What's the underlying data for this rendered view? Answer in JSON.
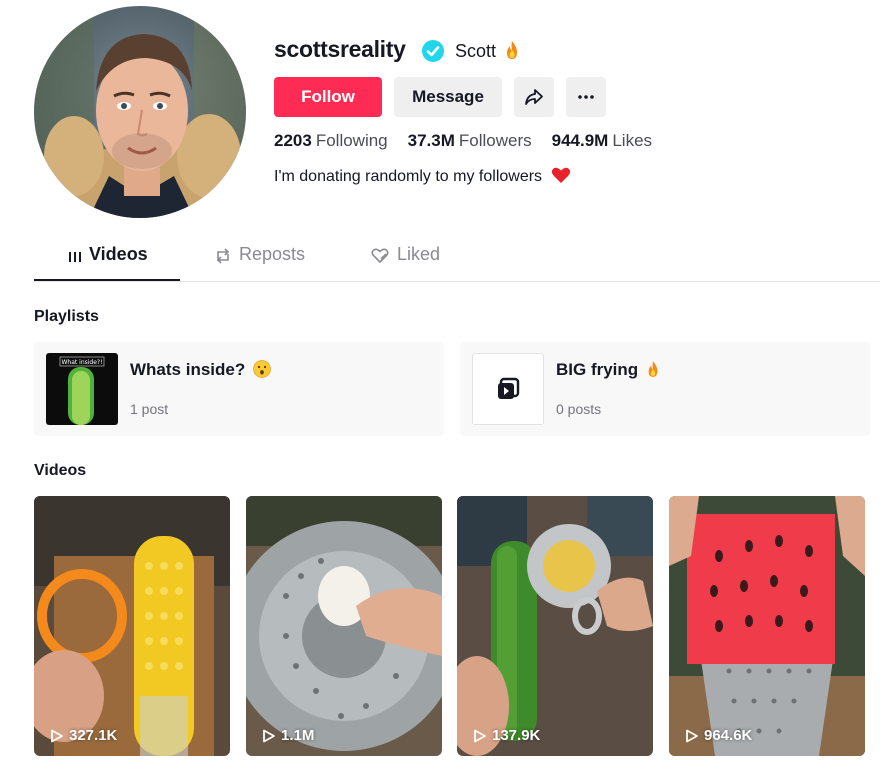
{
  "profile": {
    "username": "scottsreality",
    "display_name": "Scott",
    "follow_label": "Follow",
    "message_label": "Message",
    "bio": "I'm donating randomly to my followers"
  },
  "stats": [
    {
      "value": "2203",
      "label": "Following"
    },
    {
      "value": "37.3M",
      "label": "Followers"
    },
    {
      "value": "944.9M",
      "label": "Likes"
    }
  ],
  "tabs": [
    {
      "label": "Videos",
      "icon": "grid-icon",
      "active": true
    },
    {
      "label": "Reposts",
      "icon": "repost-icon",
      "active": false
    },
    {
      "label": "Liked",
      "icon": "liked-heart-icon",
      "active": false
    }
  ],
  "sections": {
    "playlists_title": "Playlists",
    "videos_title": "Videos"
  },
  "playlists": [
    {
      "name": "Whats inside?",
      "count": "1 post",
      "thumb_caption": "What inside?!"
    },
    {
      "name": "BIG frying",
      "count": "0 posts"
    }
  ],
  "videos": [
    {
      "views": "327.1K",
      "subject": "corn-on-cob"
    },
    {
      "views": "1.1M",
      "subject": "steamer-basket-egg"
    },
    {
      "views": "137.9K",
      "subject": "cucumber-slicer"
    },
    {
      "views": "964.6K",
      "subject": "watermelon-grater"
    }
  ],
  "colors": {
    "accent": "#fe2c55",
    "verified": "#20d5ec",
    "heart": "#e8222d",
    "text_primary": "#161823",
    "text_secondary": "#8a8b91"
  }
}
